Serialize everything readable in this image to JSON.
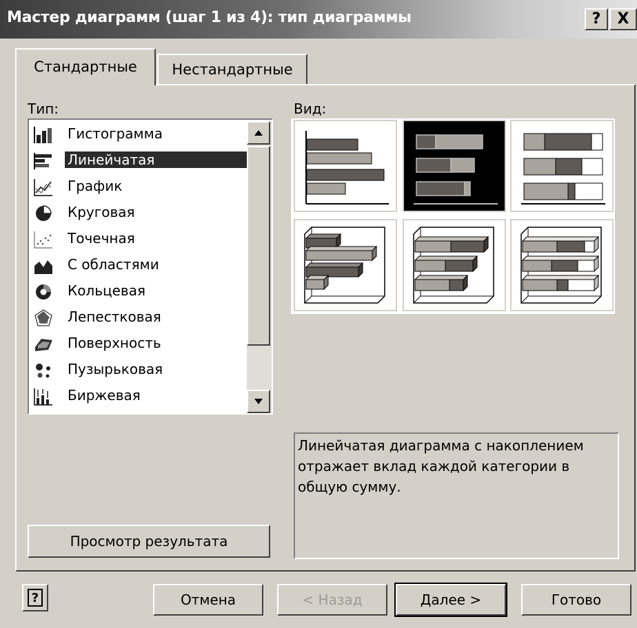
{
  "window": {
    "title": "Мастер диаграмм (шаг 1 из 4): тип диаграммы",
    "help_label": "?",
    "close_label": "X"
  },
  "tabs": [
    {
      "label": "Стандартные",
      "active": true
    },
    {
      "label": "Нестандартные",
      "active": false
    }
  ],
  "type_section": {
    "label": "Тип:"
  },
  "chart_types": [
    {
      "label": "Гистограмма",
      "icon": "column-chart-icon"
    },
    {
      "label": "Линейчатая",
      "icon": "bar-chart-icon",
      "selected": true
    },
    {
      "label": "График",
      "icon": "line-chart-icon"
    },
    {
      "label": "Круговая",
      "icon": "pie-chart-icon"
    },
    {
      "label": "Точечная",
      "icon": "scatter-chart-icon"
    },
    {
      "label": "С областями",
      "icon": "area-chart-icon"
    },
    {
      "label": "Кольцевая",
      "icon": "donut-chart-icon"
    },
    {
      "label": "Лепестковая",
      "icon": "radar-chart-icon"
    },
    {
      "label": "Поверхность",
      "icon": "surface-chart-icon"
    },
    {
      "label": "Пузырьковая",
      "icon": "bubble-chart-icon"
    },
    {
      "label": "Биржевая",
      "icon": "stock-chart-icon"
    }
  ],
  "view_section": {
    "label": "Вид:"
  },
  "subtypes": [
    {
      "name": "clustered-bar",
      "selected": false
    },
    {
      "name": "stacked-bar",
      "selected": true
    },
    {
      "name": "100-stacked-bar",
      "selected": false
    },
    {
      "name": "3d-clustered-bar",
      "selected": false
    },
    {
      "name": "3d-stacked-bar",
      "selected": false
    },
    {
      "name": "3d-100-stacked-bar",
      "selected": false
    }
  ],
  "description": "Линейчатая диаграмма с накоплением отражает вклад каждой категории в общую сумму.",
  "buttons": {
    "preview": "Просмотр результата",
    "help": "?",
    "cancel": "Отмена",
    "back": "< Назад",
    "next": "Далее >",
    "finish": "Готово"
  },
  "colors": {
    "dark_bar": "#5f5a55",
    "light_bar": "#a8a39c",
    "white_bar": "#ffffff"
  }
}
